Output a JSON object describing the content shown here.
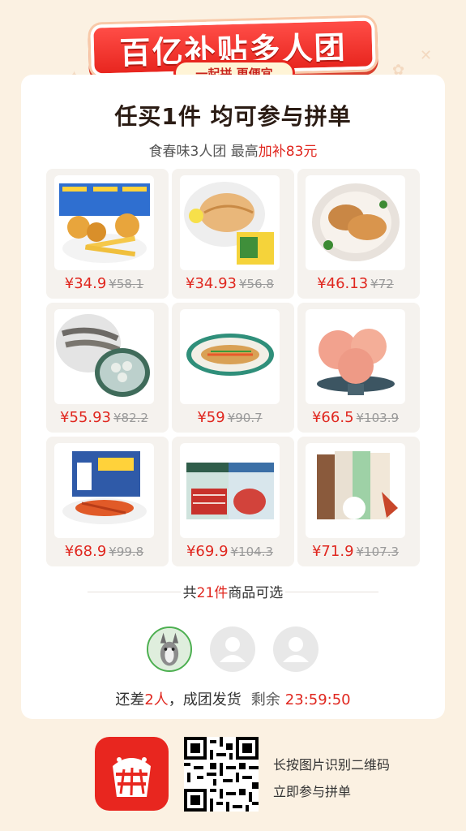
{
  "banner": {
    "title": "百亿补贴多人团",
    "subtitle": "一起拼 更便宜"
  },
  "card": {
    "title": "任买1件 均可参与拼单",
    "subtitle_prefix": "食春味3人团 最高",
    "subtitle_highlight": "加补83元"
  },
  "products": [
    {
      "name": "fried-snack-pack",
      "price": "¥34.9",
      "original": "¥58.1"
    },
    {
      "name": "chicken-breast",
      "price": "¥34.93",
      "original": "¥56.8"
    },
    {
      "name": "pork-cutlet",
      "price": "¥46.13",
      "original": "¥72"
    },
    {
      "name": "shrimp",
      "price": "¥55.93",
      "original": "¥82.2"
    },
    {
      "name": "steamed-fish",
      "price": "¥59",
      "original": "¥90.7"
    },
    {
      "name": "shrimp-balls",
      "price": "¥66.5",
      "original": "¥103.9"
    },
    {
      "name": "lobster-box",
      "price": "¥68.9",
      "original": "¥99.8"
    },
    {
      "name": "beef-slices",
      "price": "¥69.9",
      "original": "¥104.3"
    },
    {
      "name": "ice-cream",
      "price": "¥71.9",
      "original": "¥107.3"
    }
  ],
  "summary": {
    "prefix": "共",
    "count": "21件",
    "suffix": "商品可选"
  },
  "group": {
    "prefix": "还差",
    "count": "2人",
    "suffix": "，成团发货",
    "remaining_label": "剩余",
    "timer": "23:59:50"
  },
  "footer": {
    "line1": "长按图片识别二维码",
    "line2": "立即参与拼单"
  },
  "colors": {
    "accent": "#e0271f",
    "background": "#fbf1e2"
  }
}
